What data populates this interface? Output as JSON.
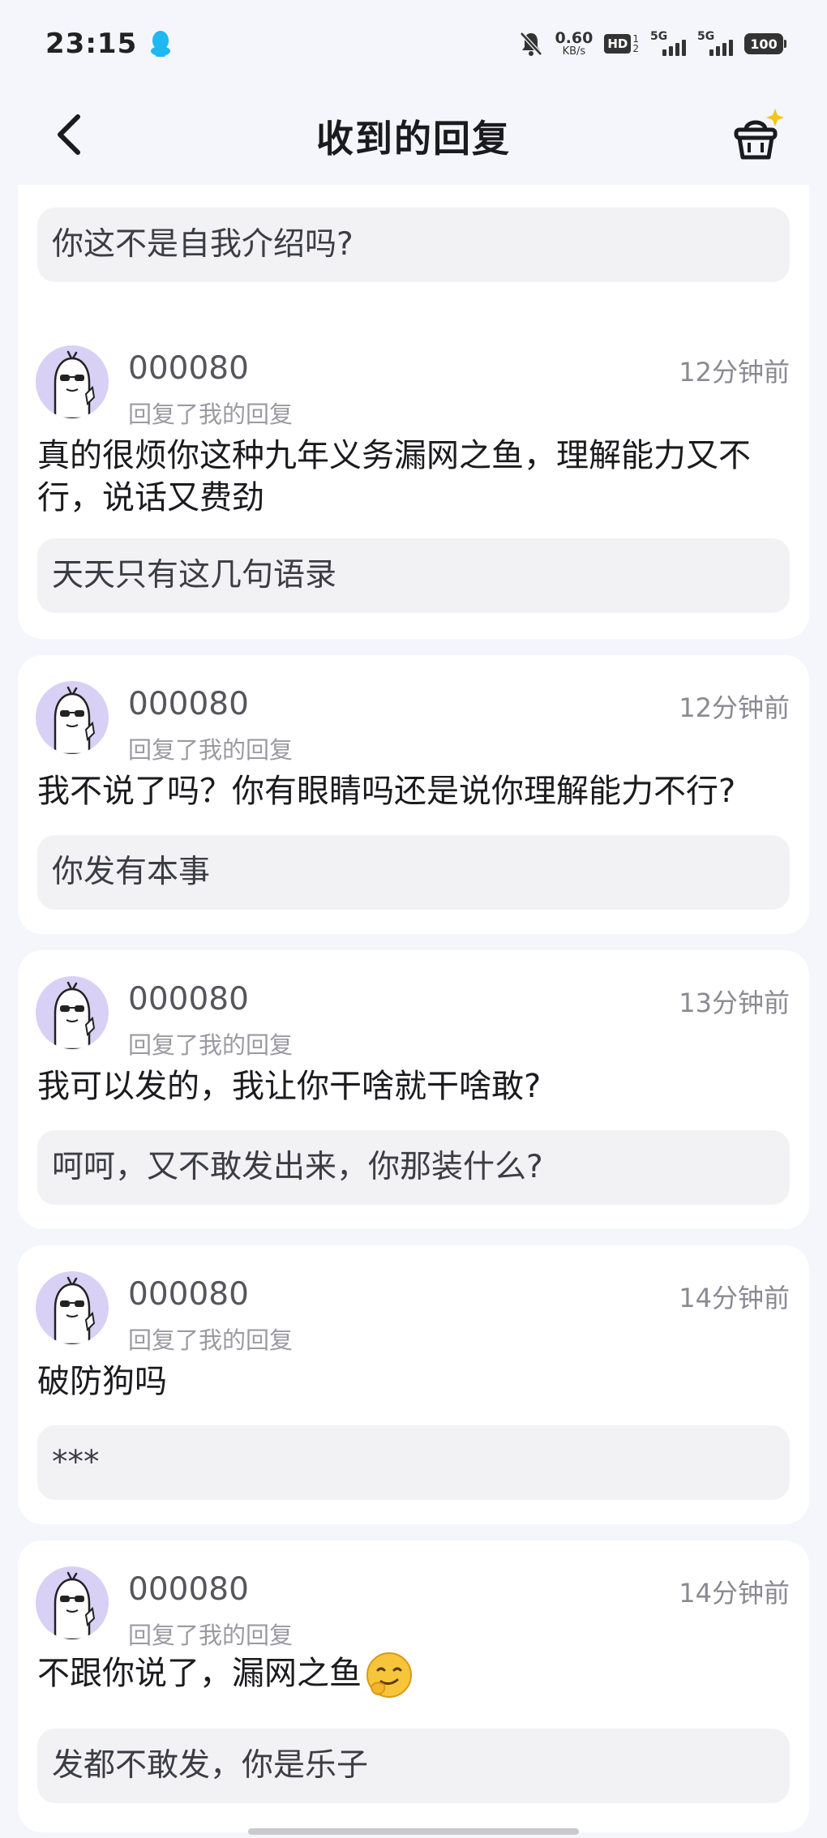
{
  "status_bar": {
    "time": "23:15",
    "net_speed_value": "0.60",
    "net_speed_unit": "KB/s",
    "hd_label": "HD",
    "hd_sub_top": "1",
    "hd_sub_bottom": "2",
    "signal1_label": "5G",
    "signal2_label": "5G",
    "battery": "100",
    "icons": [
      "qq-icon",
      "mute-bell-icon",
      "signal-icon",
      "battery-icon"
    ]
  },
  "header": {
    "title": "收到的回复",
    "back_icon": "chevron-left-icon",
    "right_icon": "basket-icon"
  },
  "partial_card": {
    "quote": "你这不是自我介绍吗?"
  },
  "replies": [
    {
      "username": "000080",
      "action": "回复了我的回复",
      "time": "12分钟前",
      "message": "真的很烦你这种九年义务漏网之鱼，理解能力又不行，说话又费劲",
      "quote": "天天只有这几句语录"
    },
    {
      "username": "000080",
      "action": "回复了我的回复",
      "time": "12分钟前",
      "message": "我不说了吗？你有眼睛吗还是说你理解能力不行?",
      "quote": "你发有本事"
    },
    {
      "username": "000080",
      "action": "回复了我的回复",
      "time": "13分钟前",
      "message": "我可以发的，我让你干啥就干啥敢?",
      "quote": "呵呵，又不敢发出来，你那装什么?"
    },
    {
      "username": "000080",
      "action": "回复了我的回复",
      "time": "14分钟前",
      "message": "破防狗吗",
      "quote": "***"
    },
    {
      "username": "000080",
      "action": "回复了我的回复",
      "time": "14分钟前",
      "message": "不跟你说了，漏网之鱼",
      "emoji": "smirk-emoji",
      "quote": "发都不敢发，你是乐子"
    }
  ],
  "colors": {
    "background": "#f4f6fb",
    "card": "#ffffff",
    "quote_bg": "#f2f2f5",
    "avatar_bg": "#d8d0f5",
    "accent_qq": "#1fb8f0"
  }
}
